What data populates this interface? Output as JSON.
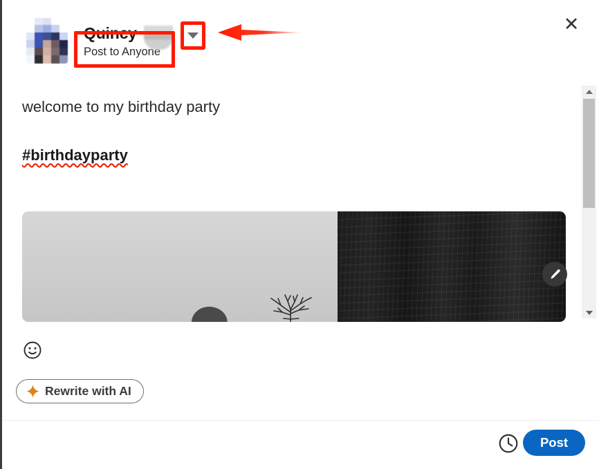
{
  "modal": {
    "close_label": "✕"
  },
  "header": {
    "author_name": "Quincy",
    "visibility_label": "Post to Anyone",
    "chevron_icon": "chevron-down-icon",
    "avatar_icon": "blurred-avatar"
  },
  "annotations": {
    "arrow_color": "#ff1a00",
    "box_color": "#ff1a00",
    "arrow_direction": "left"
  },
  "editor": {
    "post_text": "welcome to my birthday party",
    "hashtag": "#birthdayparty",
    "spellcheck_underline_color": "#ee2200",
    "media_alt": "black-and-white-cliff-photo",
    "edit_media_icon": "pencil-icon",
    "emoji_icon": "smiley-face-icon"
  },
  "rewrite": {
    "label": "Rewrite with AI",
    "sparkle_icon": "sparkle-icon",
    "sparkle_color": "#d98719"
  },
  "scrollbar": {
    "up_icon": "scroll-up-arrow-icon",
    "down_icon": "scroll-down-arrow-icon",
    "thumb": "scroll-thumb"
  },
  "footer": {
    "schedule_icon": "clock-icon",
    "post_label": "Post",
    "post_color": "#0a66c2"
  }
}
